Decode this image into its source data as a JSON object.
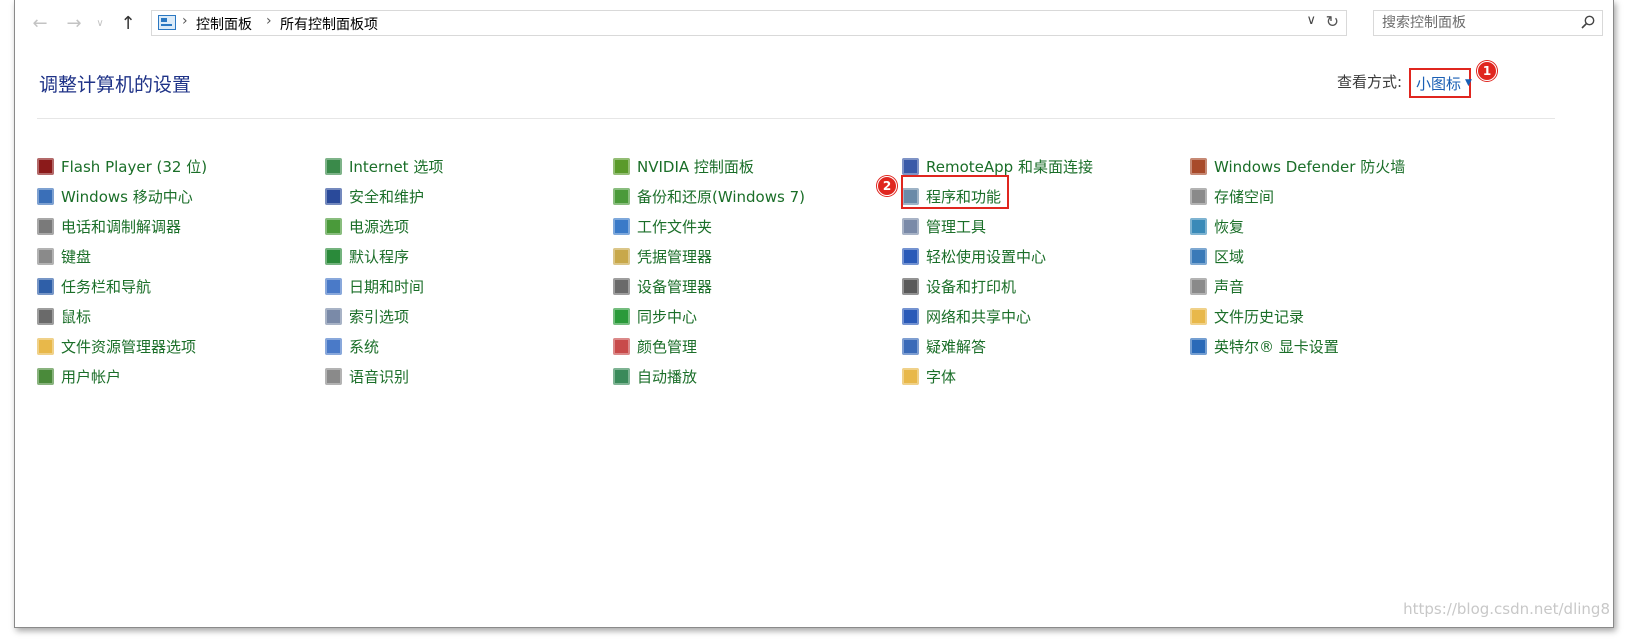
{
  "address_bar": {
    "breadcrumbs": [
      "控制面板",
      "所有控制面板项"
    ]
  },
  "search": {
    "placeholder": "搜索控制面板"
  },
  "header": {
    "title": "调整计算机的设置",
    "view_label": "查看方式:",
    "view_value": "小图标"
  },
  "annotations": {
    "badge1": "1",
    "badge2": "2"
  },
  "columns": [
    [
      {
        "label": "Flash Player (32 位)",
        "icon": "flash-player-icon",
        "color": "#8b1a1a"
      },
      {
        "label": "Windows 移动中心",
        "icon": "mobility-center-icon",
        "color": "#3a6fb8"
      },
      {
        "label": "电话和调制解调器",
        "icon": "phone-modem-icon",
        "color": "#7a7a7a"
      },
      {
        "label": "键盘",
        "icon": "keyboard-icon",
        "color": "#8a8a8a"
      },
      {
        "label": "任务栏和导航",
        "icon": "taskbar-icon",
        "color": "#2f5fa8"
      },
      {
        "label": "鼠标",
        "icon": "mouse-icon",
        "color": "#6a6a6a"
      },
      {
        "label": "文件资源管理器选项",
        "icon": "folder-options-icon",
        "color": "#e8b84a"
      },
      {
        "label": "用户帐户",
        "icon": "user-accounts-icon",
        "color": "#4a8a3a"
      }
    ],
    [
      {
        "label": "Internet 选项",
        "icon": "internet-options-icon",
        "color": "#3a8a4a"
      },
      {
        "label": "安全和维护",
        "icon": "security-flag-icon",
        "color": "#2a4a9a"
      },
      {
        "label": "电源选项",
        "icon": "power-options-icon",
        "color": "#4a9a3a"
      },
      {
        "label": "默认程序",
        "icon": "default-programs-icon",
        "color": "#2a8a3a"
      },
      {
        "label": "日期和时间",
        "icon": "date-time-icon",
        "color": "#4a7ac8"
      },
      {
        "label": "索引选项",
        "icon": "indexing-icon",
        "color": "#7a8aa8"
      },
      {
        "label": "系统",
        "icon": "system-icon",
        "color": "#4a7ac8"
      },
      {
        "label": "语音识别",
        "icon": "microphone-icon",
        "color": "#8a8a8a"
      }
    ],
    [
      {
        "label": "NVIDIA 控制面板",
        "icon": "nvidia-icon",
        "color": "#5a9a2a"
      },
      {
        "label": "备份和还原(Windows 7)",
        "icon": "backup-restore-icon",
        "color": "#4a9a3a"
      },
      {
        "label": "工作文件夹",
        "icon": "work-folders-icon",
        "color": "#3a7ac8"
      },
      {
        "label": "凭据管理器",
        "icon": "credential-manager-icon",
        "color": "#c8a84a"
      },
      {
        "label": "设备管理器",
        "icon": "device-manager-icon",
        "color": "#6a6a6a"
      },
      {
        "label": "同步中心",
        "icon": "sync-center-icon",
        "color": "#2a9a3a"
      },
      {
        "label": "颜色管理",
        "icon": "color-management-icon",
        "color": "#c84a4a"
      },
      {
        "label": "自动播放",
        "icon": "autoplay-icon",
        "color": "#3a8a5a"
      }
    ],
    [
      {
        "label": "RemoteApp 和桌面连接",
        "icon": "remoteapp-icon",
        "color": "#3a5aa8"
      },
      {
        "label": "程序和功能",
        "icon": "programs-features-icon",
        "color": "#6a8aa8"
      },
      {
        "label": "管理工具",
        "icon": "admin-tools-icon",
        "color": "#7a8aa8"
      },
      {
        "label": "轻松使用设置中心",
        "icon": "ease-of-access-icon",
        "color": "#2a5ab8"
      },
      {
        "label": "设备和打印机",
        "icon": "printer-icon",
        "color": "#5a5a5a"
      },
      {
        "label": "网络和共享中心",
        "icon": "network-icon",
        "color": "#2a5ab8"
      },
      {
        "label": "疑难解答",
        "icon": "troubleshooting-icon",
        "color": "#3a6ab8"
      },
      {
        "label": "字体",
        "icon": "fonts-icon",
        "color": "#e8b84a"
      }
    ],
    [
      {
        "label": "Windows Defender 防火墙",
        "icon": "firewall-icon",
        "color": "#a84a2a"
      },
      {
        "label": "存储空间",
        "icon": "storage-spaces-icon",
        "color": "#8a8a8a"
      },
      {
        "label": "恢复",
        "icon": "recovery-icon",
        "color": "#3a8ab8"
      },
      {
        "label": "区域",
        "icon": "region-icon",
        "color": "#3a7ab8"
      },
      {
        "label": "声音",
        "icon": "sound-icon",
        "color": "#8a8a8a"
      },
      {
        "label": "文件历史记录",
        "icon": "file-history-icon",
        "color": "#e8b84a"
      },
      {
        "label": "英特尔® 显卡设置",
        "icon": "intel-graphics-icon",
        "color": "#2a6ab8"
      }
    ]
  ],
  "watermark": "https://blog.csdn.net/dling8"
}
